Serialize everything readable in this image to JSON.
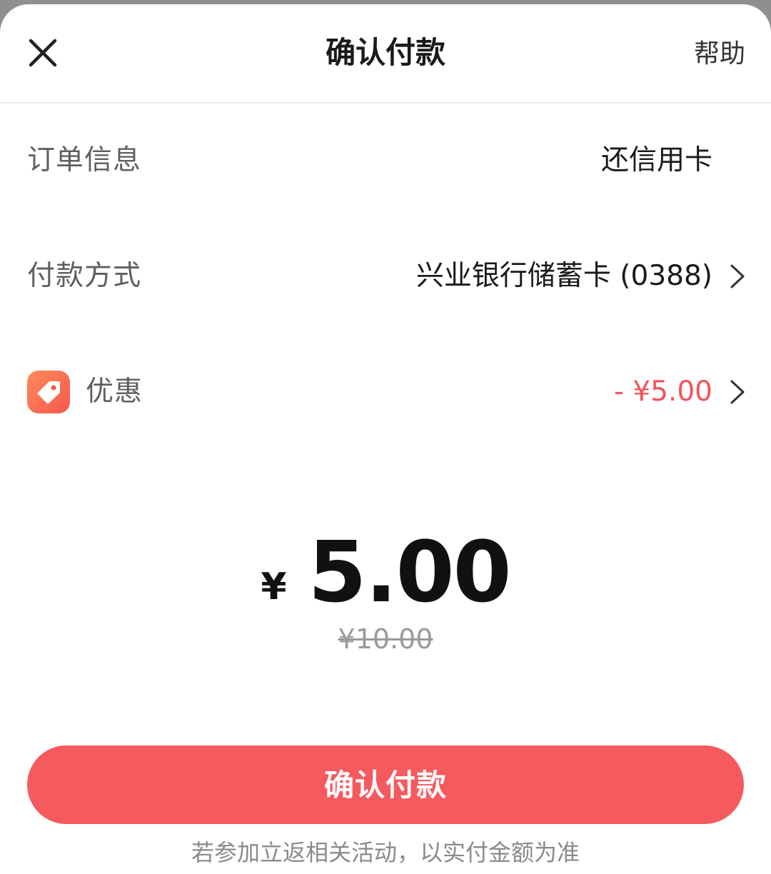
{
  "header": {
    "close_icon": "close-icon",
    "title": "确认付款",
    "help_label": "帮助"
  },
  "order_info": {
    "label": "订单信息",
    "value": "还信用卡"
  },
  "payment_method": {
    "label": "付款方式",
    "value": "兴业银行储蓄卡 (0388)",
    "chevron_icon": "chevron-right-icon"
  },
  "discount": {
    "icon": "price-tag-icon",
    "label": "优惠",
    "value": "- ¥5.00",
    "chevron_icon": "chevron-right-icon"
  },
  "amount": {
    "currency_symbol": "¥",
    "value": "5.00",
    "original_price": "¥10.00"
  },
  "confirm_button": {
    "label": "确认付款"
  },
  "footer_note": "若参加立返相关活动，以实付金额为准",
  "colors": {
    "accent": "#f55a5f",
    "discount_text": "#f2545b",
    "tag_icon_gradient_start": "#ff8a5c",
    "tag_icon_gradient_end": "#f4584b"
  }
}
